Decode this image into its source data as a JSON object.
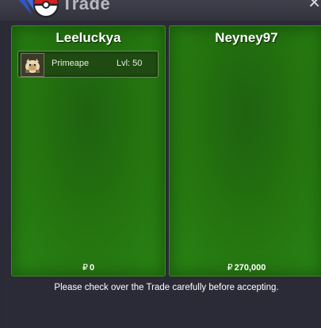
{
  "window": {
    "title": "Trade",
    "close_symbol": "✕"
  },
  "left_offer": {
    "player_name": "Leeluckya",
    "pokemon": [
      {
        "name": "Primeape",
        "level": "Lvl: 50",
        "icon": "primeape-icon"
      }
    ],
    "currency_symbol": "₽",
    "money": "0"
  },
  "right_offer": {
    "player_name": "Neyney97",
    "pokemon": [],
    "currency_symbol": "₽",
    "money": "270,000"
  },
  "notice": "Please check over the Trade carefully before accepting.",
  "colors": {
    "panel_green": "#23700f",
    "window_bg": "#2a2a36",
    "text": "#ffffff"
  }
}
